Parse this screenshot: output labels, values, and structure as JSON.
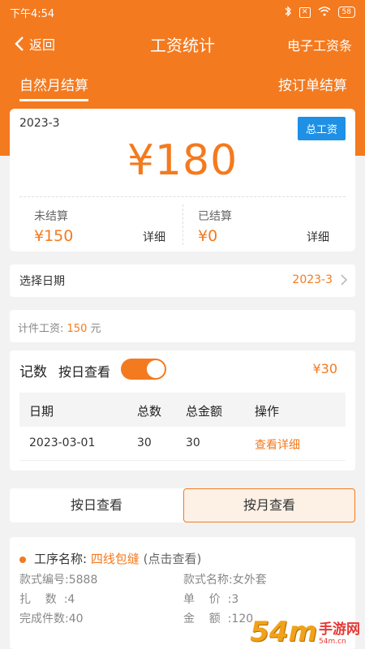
{
  "status_bar": {
    "time": "下午4:54",
    "sim_label": "✕",
    "battery": "58"
  },
  "nav": {
    "back_label": "返回",
    "title": "工资统计",
    "right_label": "电子工资条"
  },
  "tabs": {
    "left": "自然月结算",
    "right": "按订单结算"
  },
  "summary": {
    "month": "2023-3",
    "total_button": "总工资",
    "total_amount": "¥180",
    "unsettled_label": "未结算",
    "unsettled_amount": "¥150",
    "settled_label": "已结算",
    "settled_amount": "¥0",
    "detail_label": "详细"
  },
  "date_row": {
    "label": "选择日期",
    "value": "2023-3"
  },
  "piece_wage": {
    "label": "计件工资:",
    "value": "150",
    "unit": "元"
  },
  "records": {
    "title": "记数",
    "daily_view_label": "按日查看",
    "daily_view_on": true,
    "amount": "¥30",
    "columns": [
      "日期",
      "总数",
      "总金额",
      "操作"
    ],
    "rows": [
      {
        "date": "2023-03-01",
        "count": "30",
        "amount": "30",
        "action": "查看详细"
      }
    ]
  },
  "view_switch": {
    "left": "按日查看",
    "right": "按月查看"
  },
  "process": {
    "name_label": "工序名称:",
    "name": "四线包缝",
    "hint": "(点击查看)",
    "style_no": "款式编号:5888",
    "style_name": "款式名称:女外套",
    "bundle": "扎    数  :4",
    "unit_price": "单    价  :3",
    "done": "完成件数:40",
    "amount": "金    额  :120"
  },
  "watermark": {
    "logo": "54m",
    "name": "手游网",
    "url": "54m.cn"
  },
  "colors": {
    "primary": "#f47a1f",
    "blue": "#1e90e6",
    "background": "#f2f2f2"
  }
}
